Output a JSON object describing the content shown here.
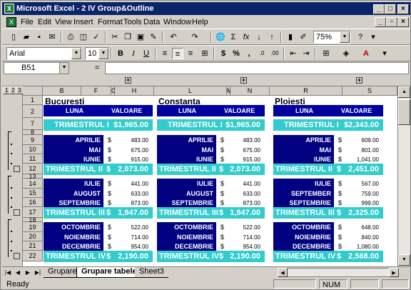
{
  "window": {
    "title": "Microsoft Excel - 2 IV Group&Outline",
    "app_icon": "excel-icon"
  },
  "menu": [
    "File",
    "Edit",
    "View",
    "Insert",
    "Format",
    "Tools",
    "Data",
    "Window",
    "Help"
  ],
  "toolbar": {
    "zoom": "75%",
    "font_name": "Arial",
    "font_size": "10"
  },
  "formula_bar": {
    "name_box": "B51",
    "fx": "=",
    "content": ""
  },
  "outline": {
    "levels": [
      "1",
      "2",
      "3"
    ]
  },
  "columns": [
    "B",
    "F",
    "G",
    "H",
    "L",
    "M",
    "N",
    "R",
    "S"
  ],
  "rows": [
    "1",
    "2",
    "7",
    "8",
    "9",
    "10",
    "11",
    "12",
    "13",
    "14",
    "15",
    "16",
    "17",
    "18",
    "19",
    "20",
    "21",
    "22"
  ],
  "header": {
    "luna": "LUNA",
    "valoare": "VALOARE"
  },
  "cities": [
    {
      "name": "Bucuresti",
      "t1": {
        "label": "TRIMESTRUL I",
        "value": "$1,965.00"
      },
      "q2": {
        "months": [
          "APRILIE",
          "MAI",
          "IUNIE"
        ],
        "values": [
          "483.00",
          "675.00",
          "915.00"
        ],
        "label": "TRIMESTRUL II",
        "value": "2,073.00"
      },
      "q3": {
        "months": [
          "IULIE",
          "AUGUST",
          "SEPTEMBRIE"
        ],
        "values": [
          "441.00",
          "633.00",
          "873.00"
        ],
        "label": "TRIMESTRUL III",
        "value": "1,947.00"
      },
      "q4": {
        "months": [
          "OCTOMBRIE",
          "NOIEMBRIE",
          "DECEMBRIE"
        ],
        "values": [
          "522.00",
          "714.00",
          "954.00"
        ],
        "label": "TRIMESTRUL IV",
        "value": "2,190.00"
      }
    },
    {
      "name": "Constanta",
      "t1": {
        "label": "TRIMESTRUL I",
        "value": "$1,965.00"
      },
      "q2": {
        "months": [
          "APRILIE",
          "MAI",
          "IUNIE"
        ],
        "values": [
          "483.00",
          "675.00",
          "915.00"
        ],
        "label": "TRIMESTRUL II",
        "value": "2,073.00"
      },
      "q3": {
        "months": [
          "IULIE",
          "AUGUST",
          "SEPTEMBRIE"
        ],
        "values": [
          "441.00",
          "633.00",
          "873.00"
        ],
        "label": "TRIMESTRUL III",
        "value": "1,947.00"
      },
      "q4": {
        "months": [
          "OCTOMBRIE",
          "NOIEMBRIE",
          "DECEMBRIE"
        ],
        "values": [
          "522.00",
          "714.00",
          "954.00"
        ],
        "label": "TRIMESTRUL IV",
        "value": "2,190.00"
      }
    },
    {
      "name": "Ploiesti",
      "t1": {
        "label": "TRIMESTRUL I",
        "value": "$2,343.00"
      },
      "q2": {
        "months": [
          "APRILIE",
          "MAI",
          "IUNIE"
        ],
        "values": [
          "609.00",
          "801.00",
          "1,041.00"
        ],
        "label": "TRIMESTRUL II",
        "value": "2,451.00"
      },
      "q3": {
        "months": [
          "IULIE",
          "SEPTEMBER",
          "SEPTEMBRIE"
        ],
        "values": [
          "567.00",
          "759.00",
          "999.00"
        ],
        "label": "TRIMESTRUL III",
        "value": "2,325.00"
      },
      "q4": {
        "months": [
          "OCTOMBRIE",
          "NOIEMBRIE",
          "DECEMBRIE"
        ],
        "values": [
          "648.00",
          "840.00",
          "1,080.00"
        ],
        "label": "TRIMESTRUL IV",
        "value": "2,568.00"
      }
    }
  ],
  "currency": "$",
  "sheets": [
    "Grupare",
    "Grupare tabele",
    "Sheet3"
  ],
  "status": {
    "left": "Ready",
    "num": "NUM"
  },
  "colors": {
    "header_bg": "#0000a0",
    "month_bg": "#000080",
    "quarter_bg": "#33cccc",
    "title_bg": "#0a246a"
  }
}
